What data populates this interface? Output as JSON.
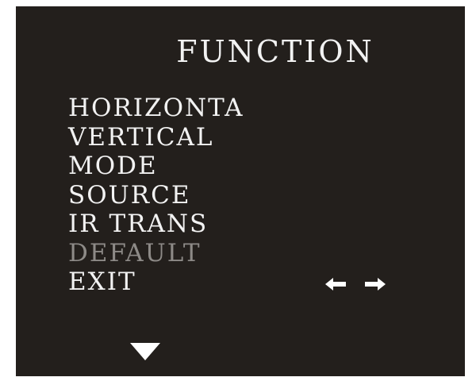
{
  "osd": {
    "title": "FUNCTION",
    "menu_items": [
      {
        "label": "HORIZONTA",
        "state": "enabled"
      },
      {
        "label": "VERTICAL",
        "state": "enabled"
      },
      {
        "label": "MODE",
        "state": "enabled"
      },
      {
        "label": "SOURCE",
        "state": "enabled"
      },
      {
        "label": "IR TRANS",
        "state": "enabled"
      },
      {
        "label": "DEFAULT",
        "state": "disabled"
      },
      {
        "label": "EXIT",
        "state": "enabled"
      }
    ],
    "icons": {
      "left": "left-arrow-icon",
      "right": "right-arrow-icon",
      "down": "down-triangle-icon"
    },
    "colors": {
      "background": "#231f1c",
      "text": "#f2f2f2",
      "disabled_text": "#8d8a87",
      "frame": "#ffffff"
    }
  }
}
